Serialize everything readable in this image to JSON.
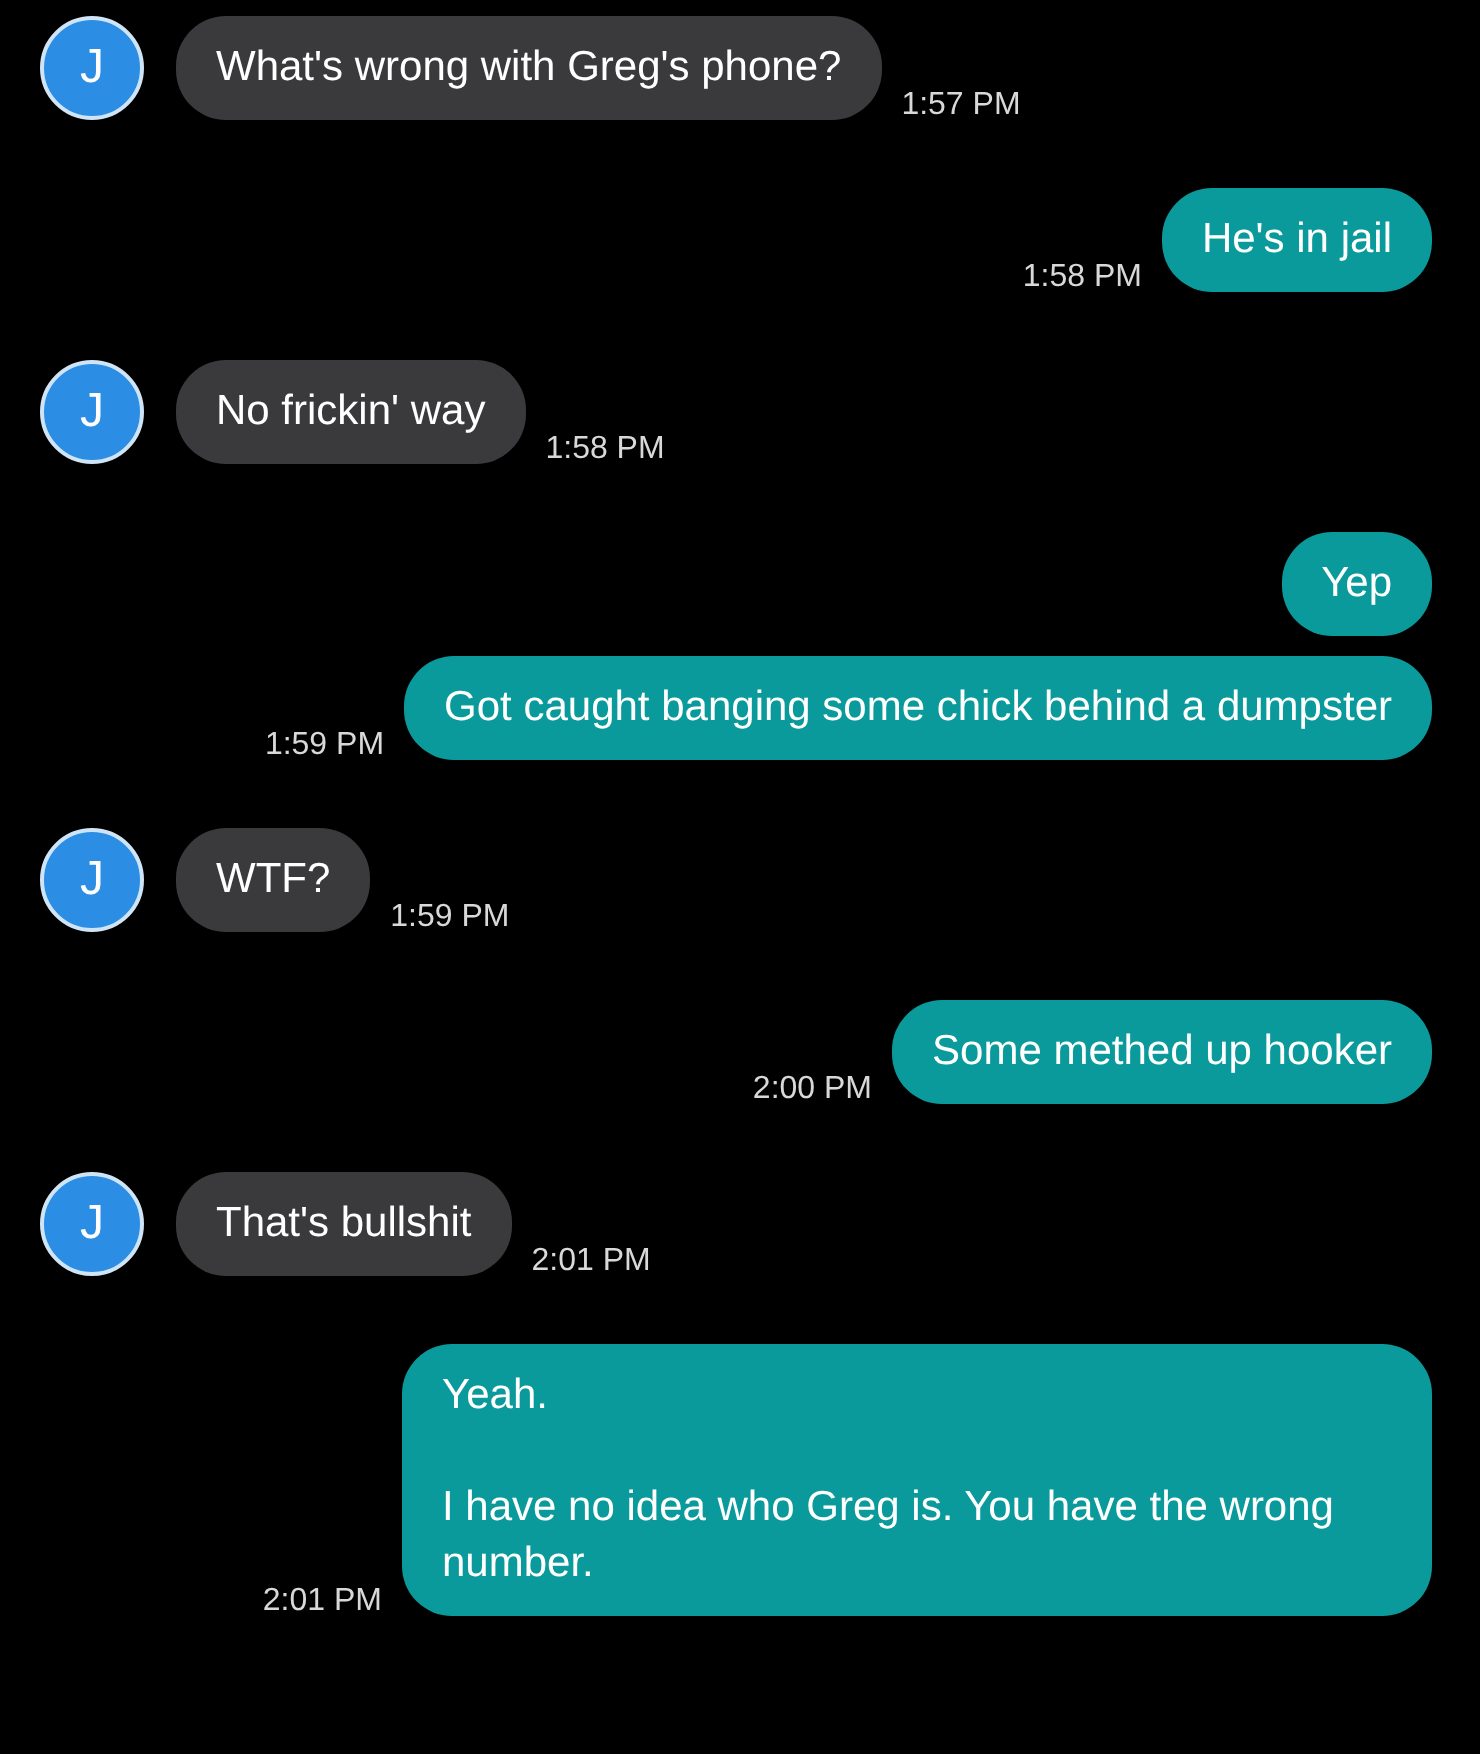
{
  "messages": [
    {
      "kind": "incoming",
      "avatar": "J",
      "text": "What's wrong with Greg's phone?",
      "time": "1:57 PM"
    },
    {
      "kind": "outgoing",
      "text": "He's in jail",
      "time": "1:58 PM"
    },
    {
      "kind": "incoming",
      "avatar": "J",
      "text": "No frickin' way",
      "time": "1:58 PM"
    },
    {
      "kind": "outgoing",
      "text": "Yep"
    },
    {
      "kind": "outgoing",
      "text": "Got caught banging some chick behind a dumpster",
      "time": "1:59 PM"
    },
    {
      "kind": "incoming",
      "avatar": "J",
      "text": "WTF?",
      "time": "1:59 PM"
    },
    {
      "kind": "outgoing",
      "text": "Some methed up hooker",
      "time": "2:00 PM"
    },
    {
      "kind": "incoming",
      "avatar": "J",
      "text": "That's bullshit",
      "time": "2:01 PM"
    },
    {
      "kind": "outgoing",
      "text": "Yeah.\n\nI have no idea who Greg is. You have the wrong number.",
      "time": "2:01 PM"
    }
  ]
}
